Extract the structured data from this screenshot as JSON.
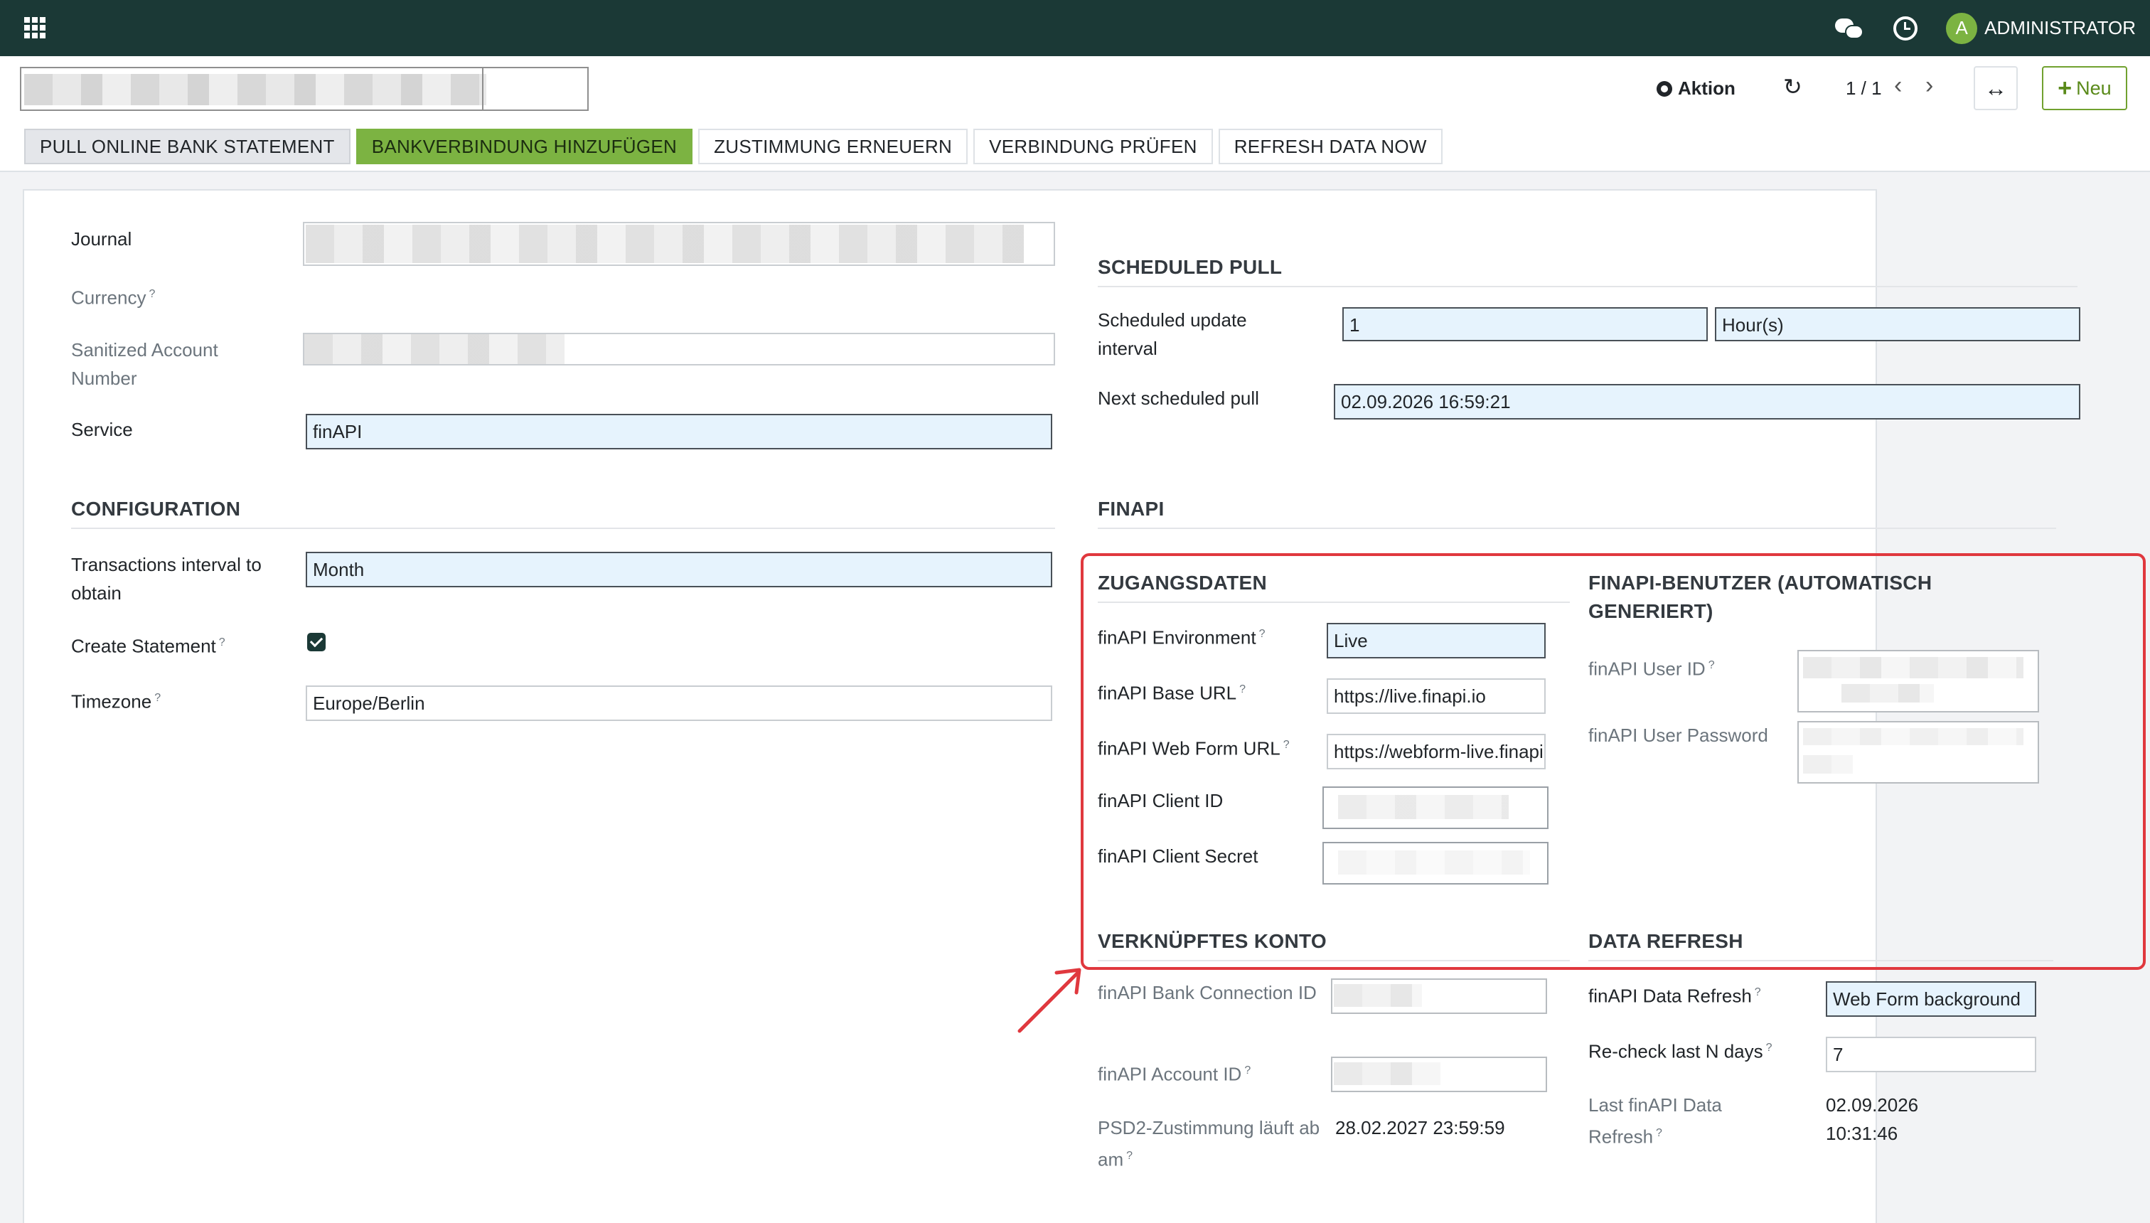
{
  "navbar": {
    "user_initial": "A",
    "user_name": "ADMINISTRATOR"
  },
  "control_panel": {
    "aktion_label": "Aktion",
    "pager": "1 / 1",
    "new_label": "Neu",
    "buttons": [
      "PULL ONLINE BANK STATEMENT",
      "BANKVERBINDUNG HINZUFÜGEN",
      "ZUSTIMMUNG ERNEUERN",
      "VERBINDUNG PRÜFEN",
      "REFRESH DATA NOW"
    ]
  },
  "left": {
    "journal_label": "Journal",
    "currency_label": "Currency",
    "sanitized_label": "Sanitized Account Number",
    "service_label": "Service",
    "service_value": "finAPI",
    "configuration_title": "CONFIGURATION",
    "tx_interval_label": "Transactions interval to obtain",
    "tx_interval_value": "Month",
    "create_statement_label": "Create Statement",
    "timezone_label": "Timezone",
    "timezone_value": "Europe/Berlin"
  },
  "scheduled": {
    "title": "SCHEDULED PULL",
    "interval_label": "Scheduled update interval",
    "interval_value": "1",
    "interval_unit": "Hour(s)",
    "next_label": "Next scheduled pull",
    "next_value": "02.09.2026 16:59:21"
  },
  "finapi": {
    "title": "FINAPI",
    "zugangsdaten_title": "ZUGANGSDATEN",
    "env_label": "finAPI Environment",
    "env_value": "Live",
    "base_url_label": "finAPI Base URL",
    "base_url_value": "https://live.finapi.io",
    "web_form_label": "finAPI Web Form URL",
    "web_form_value": "https://webform-live.finapi.io",
    "client_id_label": "finAPI Client ID",
    "client_secret_label": "finAPI Client Secret",
    "user_title": "FINAPI-BENUTZER (AUTOMATISCH GENERIERT)",
    "user_id_label": "finAPI User ID",
    "user_password_label": "finAPI User Password",
    "konto_title": "VERKNÜPFTES KONTO",
    "bank_conn_label": "finAPI Bank Connection ID",
    "account_id_label": "finAPI Account ID",
    "psd2_label": "PSD2-Zustimmung läuft ab am",
    "psd2_value": "28.02.2027 23:59:59",
    "refresh_title": "DATA REFRESH",
    "data_refresh_label": "finAPI Data Refresh",
    "data_refresh_value": "Web Form background",
    "recheck_label": "Re-check last N days",
    "recheck_value": "7",
    "last_refresh_label": "Last finAPI Data Refresh",
    "last_refresh_value": "02.09.2026 10:31:46"
  },
  "colors": {
    "navbar": "#1b3936",
    "accent_green": "#7cb342",
    "highlight": "#e0383e"
  }
}
